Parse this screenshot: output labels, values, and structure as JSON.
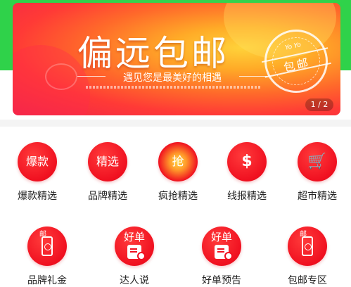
{
  "banner": {
    "title": "偏远包邮",
    "subtitle": "遇见您是最美好的相遇",
    "stamp_top": "Yo Yo",
    "stamp_text": "包邮",
    "pager": "1 / 2"
  },
  "grid_row1": [
    {
      "label": "爆款精选",
      "glyph": "爆款",
      "icon": "hot-sale-icon"
    },
    {
      "label": "品牌精选",
      "glyph": "精选",
      "icon": "brand-select-icon"
    },
    {
      "label": "疯抢精选",
      "glyph": "抢",
      "icon": "rush-buy-icon"
    },
    {
      "label": "线报精选",
      "glyph": "$",
      "icon": "deal-news-icon"
    },
    {
      "label": "超市精选",
      "glyph": "🛒",
      "icon": "supermarket-cart-icon"
    }
  ],
  "grid_row2": [
    {
      "label": "品牌礼金",
      "glyph": "邮",
      "icon": "brand-gift-ticket-icon"
    },
    {
      "label": "达人说",
      "glyph": "好单",
      "icon": "expert-says-icon"
    },
    {
      "label": "好单预告",
      "glyph": "好单",
      "icon": "good-deal-preview-icon"
    },
    {
      "label": "包邮专区",
      "glyph": "邮",
      "icon": "free-shipping-ticket-icon"
    }
  ],
  "colors": {
    "header_green": "#2fd24a",
    "icon_red": "#f01020",
    "banner_orange": "#ff6a2a"
  }
}
